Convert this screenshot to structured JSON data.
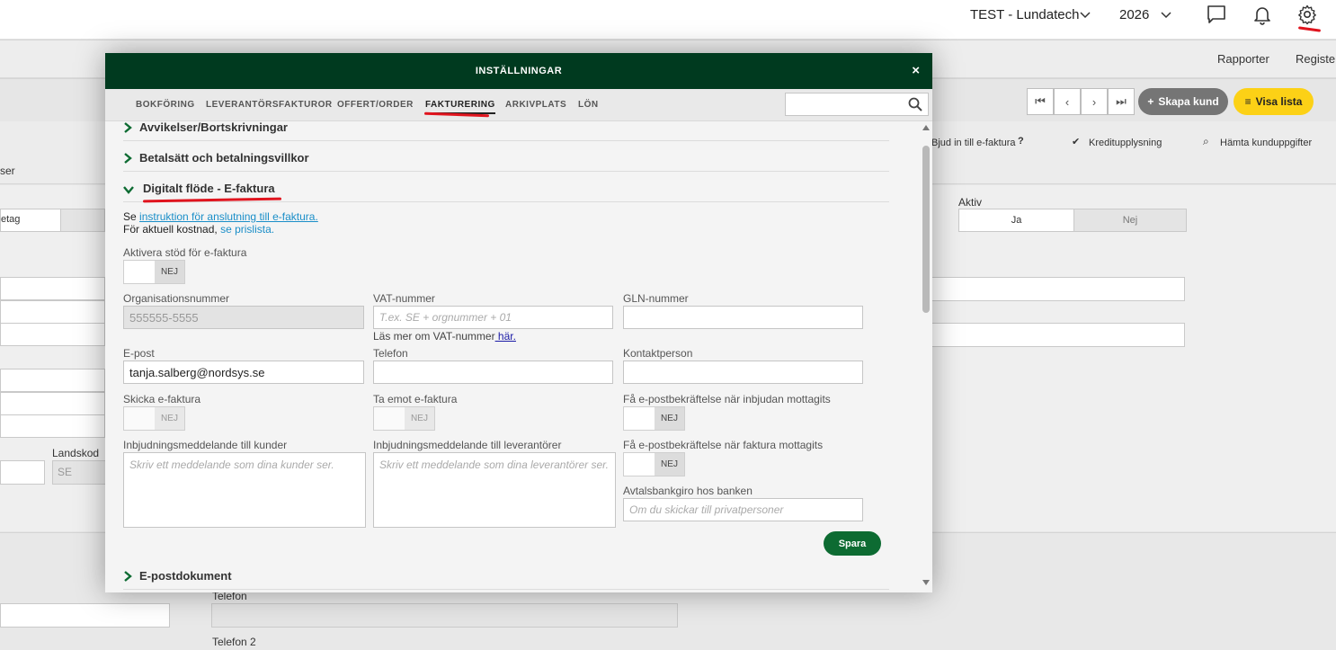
{
  "topbar": {
    "company": "TEST - Lundatech",
    "year": "2026",
    "icons": [
      "chevron-down-icon",
      "chat-icon",
      "bell-icon",
      "gear-icon"
    ]
  },
  "background": {
    "menu_rapporter": "Rapporter",
    "menu_register": "Register",
    "skapa_kund": "Skapa kund",
    "visa_lista": "Visa lista",
    "bjud_in": "Bjud in till e-faktura",
    "kreditupplysning": "Kreditupplysning",
    "hamta": "Hämta kunduppgifter",
    "ser_partial": "ser",
    "aktiv_label": "Aktiv",
    "aktiv_ja": "Ja",
    "aktiv_nej": "Nej",
    "etag_partial": "etag",
    "landskod_label": "Landskod",
    "landskod_value": "SE",
    "telefon_label": "Telefon",
    "telefon2_label": "Telefon 2"
  },
  "modal": {
    "title": "INSTÄLLNINGAR",
    "close": "×",
    "tabs": [
      "BOKFÖRING",
      "LEVERANTÖRSFAKTUROR",
      "OFFERT/ORDER",
      "FAKTURERING",
      "ARKIVPLATS",
      "LÖN"
    ],
    "active_tab": "FAKTURERING",
    "search_placeholder": ""
  },
  "sections": {
    "avvikelser": "Avvikelser/Bortskrivningar",
    "betalsatt": "Betalsätt och betalningsvillkor",
    "digitalt": "Digitalt flöde - E-faktura",
    "epostdokument": "E-postdokument"
  },
  "efaktura": {
    "se_prefix": "Se",
    "instruktion_link": "instruktion för anslutning till e-faktura.",
    "kostnad_prefix": "För aktuell kostnad,",
    "prislista_link": "se prislista.",
    "aktivera_label": "Aktivera stöd för e-faktura",
    "aktivera_state": "NEJ",
    "orgnr_label": "Organisationsnummer",
    "orgnr_value": "555555-5555",
    "vat_label": "VAT-nummer",
    "vat_placeholder": "T.ex. SE + orgnummer + 01",
    "vat_info_prefix": "Läs mer om VAT-nummer",
    "vat_info_link": " här.",
    "gln_label": "GLN-nummer",
    "gln_value": "",
    "epost_label": "E-post",
    "epost_value": "tanja.salberg@nordsys.se",
    "telefon_label": "Telefon",
    "telefon_value": "",
    "kontakt_label": "Kontaktperson",
    "kontakt_value": "",
    "skicka_label": "Skicka e-faktura",
    "skicka_state": "NEJ",
    "taemot_label": "Ta emot e-faktura",
    "taemot_state": "NEJ",
    "bekr_inbjudan_label": "Få e-postbekräftelse när inbjudan mottagits",
    "bekr_inbjudan_state": "NEJ",
    "bekr_faktura_label": "Få e-postbekräftelse när faktura mottagits",
    "bekr_faktura_state": "NEJ",
    "inbj_kunder_label": "Inbjudningsmeddelande till kunder",
    "inbj_kunder_placeholder": "Skriv ett meddelande som dina kunder ser.",
    "inbj_lev_label": "Inbjudningsmeddelande till leverantörer",
    "inbj_lev_placeholder": "Skriv ett meddelande som dina leverantörer ser.",
    "bankgiro_label": "Avtalsbankgiro hos banken",
    "bankgiro_placeholder": "Om du skickar till privatpersoner",
    "save": "Spara"
  },
  "colors": {
    "modal_header": "#003a1f",
    "save_button": "#0d6b32",
    "link": "#1a8ec8",
    "annotation": "#e0141e",
    "skapa_kund": "#757575",
    "visa_lista": "#fcd116"
  }
}
